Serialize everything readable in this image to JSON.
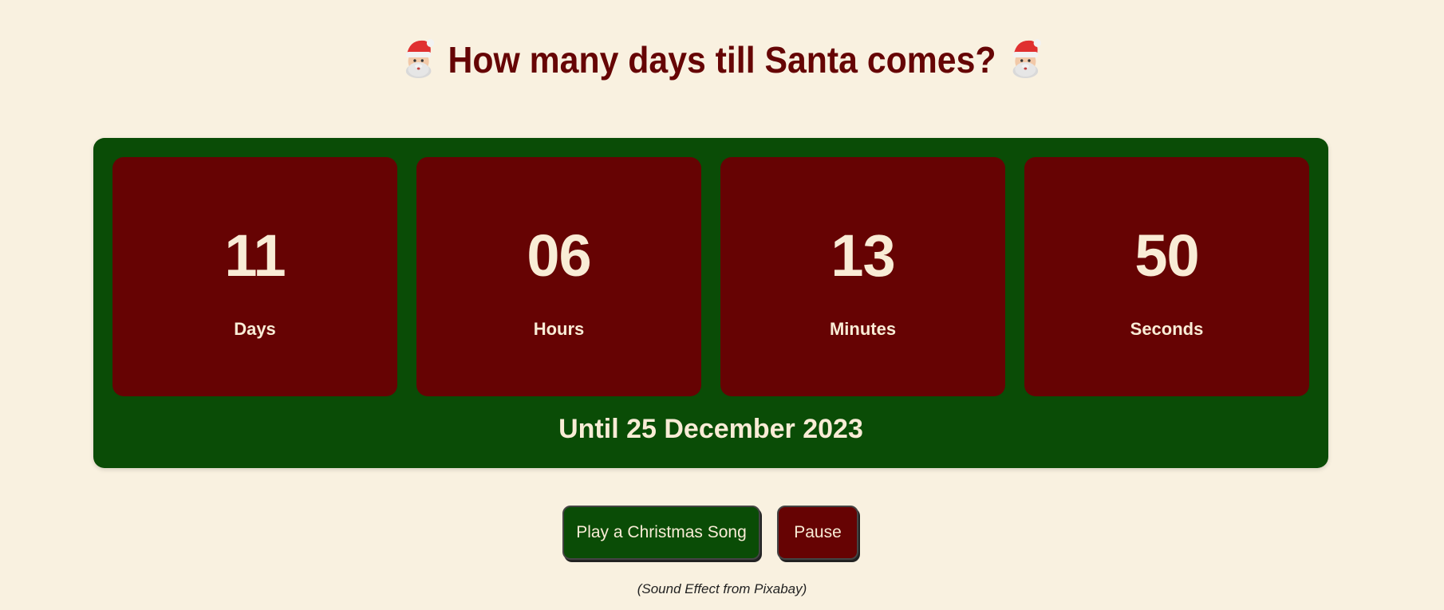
{
  "header": {
    "title": "How many days till Santa comes?",
    "left_icon": "santa-emoji",
    "right_icon": "santa-emoji"
  },
  "countdown": {
    "units": [
      {
        "value": "11",
        "label": "Days"
      },
      {
        "value": "06",
        "label": "Hours"
      },
      {
        "value": "13",
        "label": "Minutes"
      },
      {
        "value": "50",
        "label": "Seconds"
      }
    ],
    "until_text": "Until 25 December 2023"
  },
  "controls": {
    "play_label": "Play a Christmas Song",
    "pause_label": "Pause"
  },
  "footer": {
    "credit": "(Sound Effect from Pixabay)"
  },
  "colors": {
    "background": "#f9f1e0",
    "title": "#660505",
    "panel_green": "#0a4c06",
    "box_red": "#660303",
    "text_cream": "#f9ecd6"
  }
}
